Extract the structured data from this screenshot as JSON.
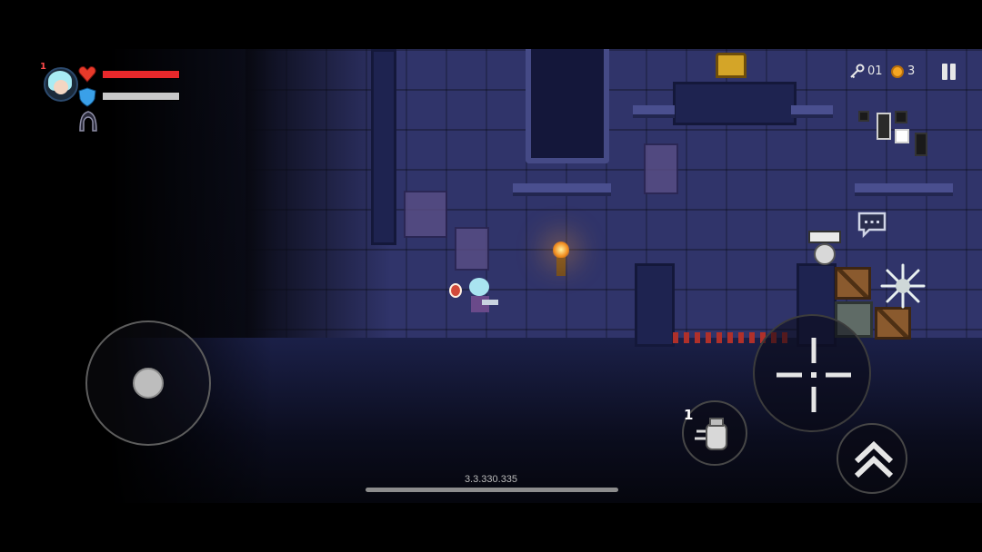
{
  "hud": {
    "level_badge": "1",
    "hp_fraction": 1.0,
    "armor_fraction": 1.0,
    "hp_color": "#e8282b",
    "armor_color": "#c9c9c9",
    "icons": {
      "heart": "heart-icon",
      "shield": "shield-icon",
      "hood": "hood-icon"
    }
  },
  "resources": {
    "keys": "01",
    "coins": "3",
    "key_icon": "key-icon",
    "coin_icon": "coin-icon",
    "coin_color": "#f5a623"
  },
  "controls": {
    "skill_charges": "1",
    "pause_icon": "pause-icon",
    "chat_icon": "chat-icon",
    "attack_icon": "crosshair-icon",
    "skill_icon": "grenade-icon",
    "jump_icon": "double-chevron-up-icon"
  },
  "footer": {
    "version": "3.3.330.335"
  }
}
